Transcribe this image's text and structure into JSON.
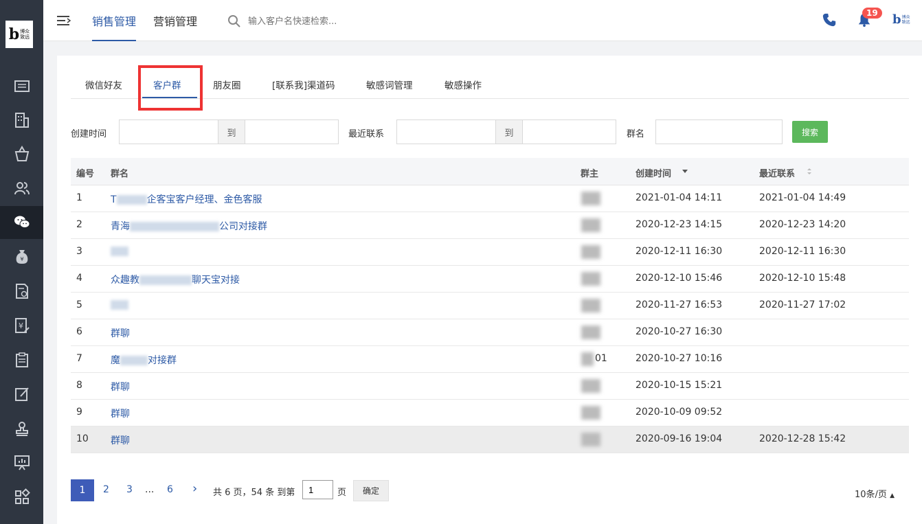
{
  "logo": {
    "letter": "b",
    "text": "博众致远"
  },
  "topbar": {
    "tabs": [
      "销售管理",
      "营销管理"
    ],
    "search_placeholder": "输入客户名快速检索...",
    "notification_count": "19",
    "brand_letter": "b",
    "brand_text": "博众致远"
  },
  "sub_tabs": [
    "微信好友",
    "客户群",
    "朋友圈",
    "[联系我]渠道码",
    "敏感词管理",
    "敏感操作"
  ],
  "filters": {
    "created_label": "创建时间",
    "to_label": "到",
    "recent_label": "最近联系",
    "group_label": "群名",
    "search_button": "搜索"
  },
  "table": {
    "headers": [
      "编号",
      "群名",
      "群主",
      "创建时间",
      "最近联系"
    ],
    "rows": [
      {
        "no": "1",
        "name_a": "T",
        "name_b": "企客宝客户经理、金色客服",
        "owner": "",
        "created": "2021-01-04 14:11",
        "recent": "2021-01-04 14:49"
      },
      {
        "no": "2",
        "name_a": "青海",
        "name_b": "公司对接群",
        "owner": "",
        "created": "2020-12-23 14:15",
        "recent": "2020-12-23 14:20"
      },
      {
        "no": "3",
        "name_a": "",
        "name_b": "",
        "owner": "",
        "created": "2020-12-11 16:30",
        "recent": "2020-12-11 16:30"
      },
      {
        "no": "4",
        "name_a": "众趣教",
        "name_b": "聊天宝对接",
        "owner": "",
        "created": "2020-12-10 15:46",
        "recent": "2020-12-10 15:48"
      },
      {
        "no": "5",
        "name_a": "",
        "name_b": "",
        "owner": "",
        "created": "2020-11-27 16:53",
        "recent": "2020-11-27 17:02"
      },
      {
        "no": "6",
        "name_a": "群聊",
        "name_b": "",
        "owner": "",
        "created": "2020-10-27 16:30",
        "recent": ""
      },
      {
        "no": "7",
        "name_a": "魔",
        "name_b": "对接群",
        "owner": "01",
        "created": "2020-10-27 10:16",
        "recent": ""
      },
      {
        "no": "8",
        "name_a": "群聊",
        "name_b": "",
        "owner": "",
        "created": "2020-10-15 15:21",
        "recent": ""
      },
      {
        "no": "9",
        "name_a": "群聊",
        "name_b": "",
        "owner": "",
        "created": "2020-10-09 09:52",
        "recent": ""
      },
      {
        "no": "10",
        "name_a": "群聊",
        "name_b": "",
        "owner": "",
        "created": "2020-09-16 19:04",
        "recent": "2020-12-28 15:42"
      }
    ]
  },
  "pagination": {
    "pages": [
      "1",
      "2",
      "3",
      "...",
      "6"
    ],
    "next": "›",
    "summary": "共 6 页，54 条 到第",
    "current_input": "1",
    "page_suffix": "页",
    "confirm": "确定",
    "page_size": "10条/页"
  }
}
